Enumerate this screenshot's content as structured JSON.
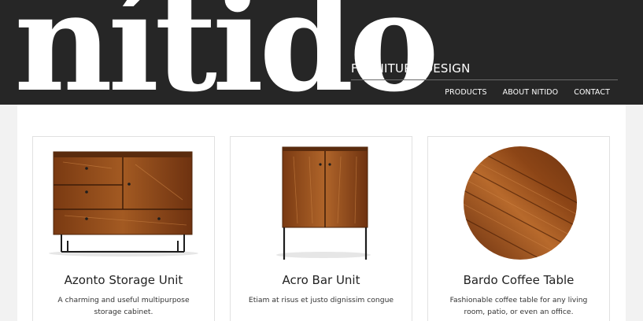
{
  "brand": {
    "logo": "nítido",
    "tagline": "FURNITURE DESIGN"
  },
  "nav": [
    {
      "label": "PRODUCTS"
    },
    {
      "label": "ABOUT NITIDO"
    },
    {
      "label": "CONTACT"
    }
  ],
  "products": [
    {
      "title": "Azonto Storage Unit",
      "description": "A charming and useful multipurpose storage cabinet."
    },
    {
      "title": "Acro Bar Unit",
      "description": "Etiam at risus et justo dignissim congue"
    },
    {
      "title": "Bardo Coffee Table",
      "description": "Fashionable coffee table for any living room, patio, or even an office."
    }
  ],
  "colors": {
    "header_bg": "#262626",
    "page_bg": "#f2f2f2",
    "wood": "#8b4513",
    "card_border": "#e1e1e1"
  }
}
